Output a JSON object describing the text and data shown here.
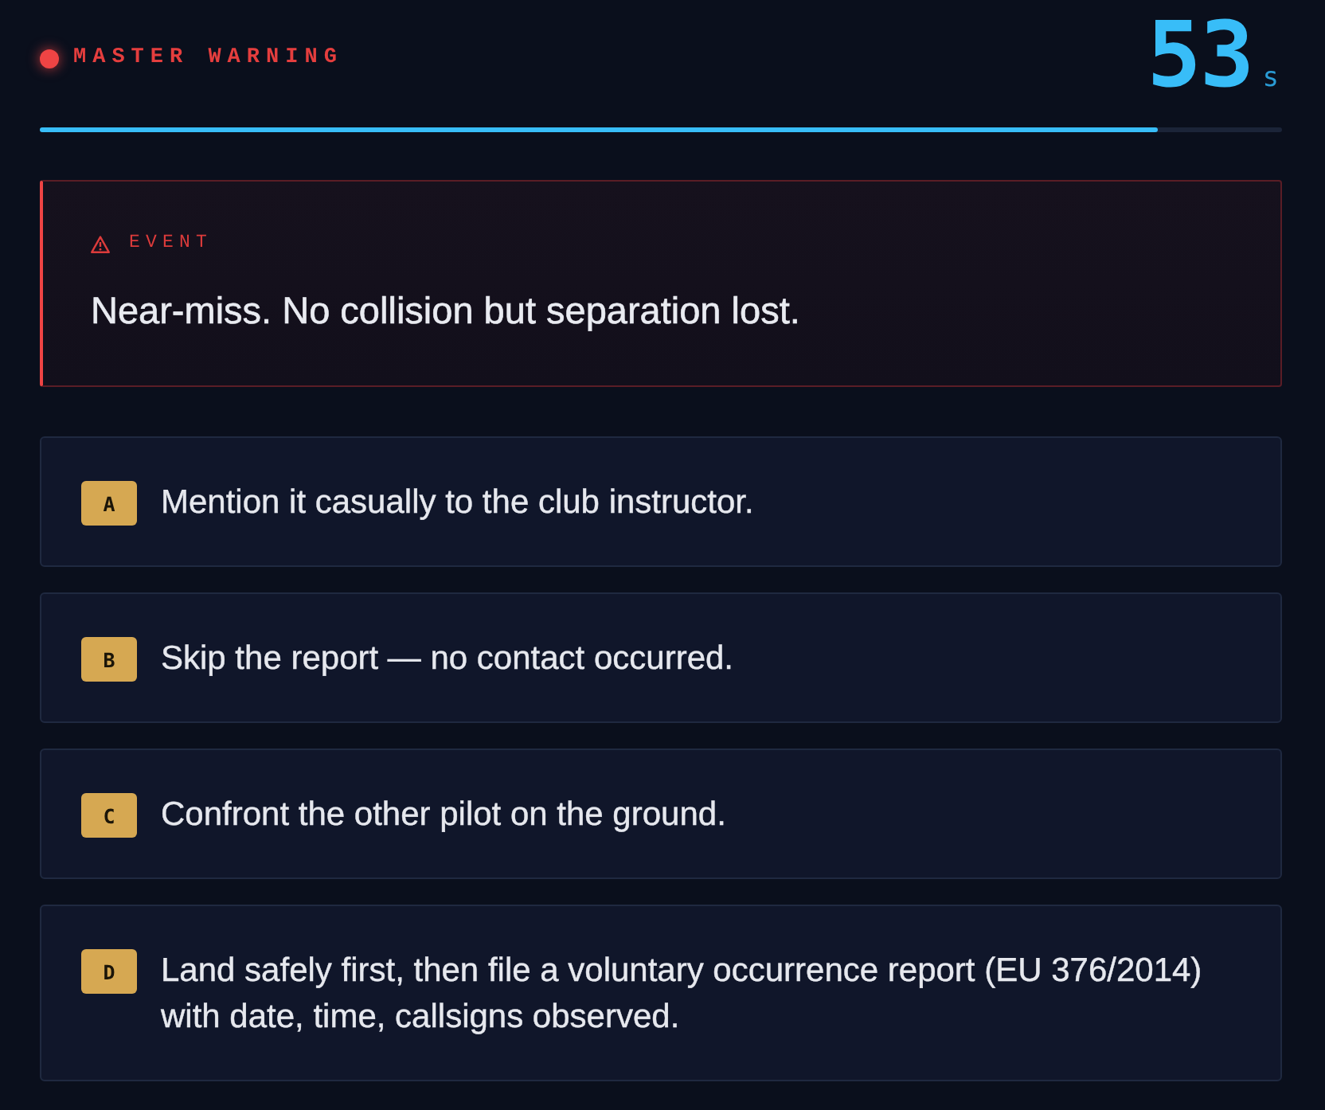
{
  "header": {
    "alert": {
      "label": "MASTER WARNING"
    },
    "timer": {
      "value": "53",
      "unit": "s",
      "level": 0.9
    }
  },
  "event": {
    "label": "EVENT",
    "text": "Near-miss. No collision but separation lost."
  },
  "options": [
    {
      "key": "A",
      "text": "Mention it casually to the club instructor.",
      "selected": false
    },
    {
      "key": "B",
      "text": "Skip the report — no contact occurred.",
      "selected": false
    },
    {
      "key": "C",
      "text": "Confront the other pilot on the ground.",
      "selected": false
    },
    {
      "key": "D",
      "text": "Land safely first, then file a voluntary occurrence report (EU 376/2014) with date, time, callsigns observed.",
      "selected": false
    }
  ]
}
